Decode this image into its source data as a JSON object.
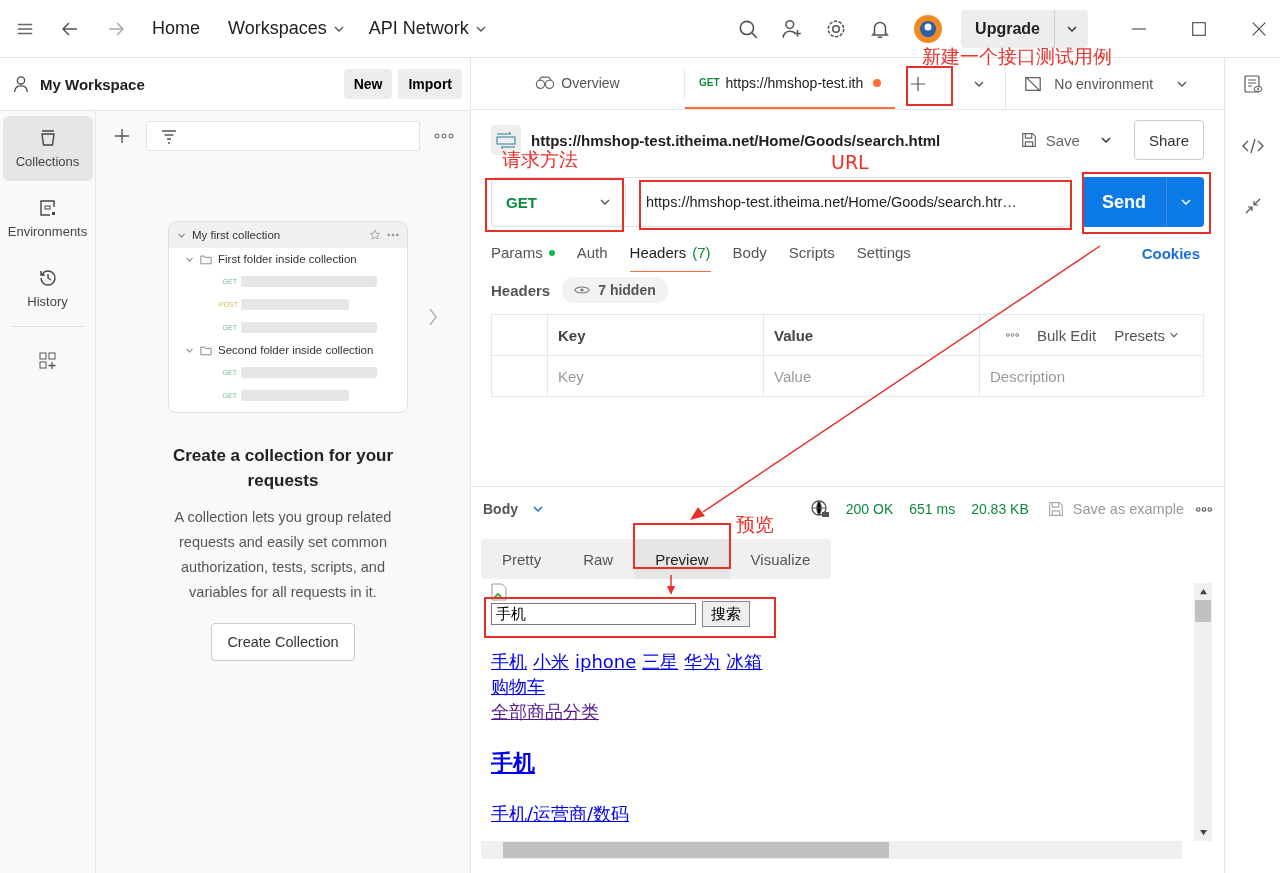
{
  "nav": {
    "home": "Home",
    "menus": [
      "Workspaces",
      "API Network"
    ],
    "upgrade": "Upgrade"
  },
  "workspace": {
    "name": "My Workspace",
    "buttons": [
      "New",
      "Import"
    ]
  },
  "rail": [
    {
      "kind": "collections",
      "label": "Collections",
      "selected": true
    },
    {
      "kind": "environments",
      "label": "Environments",
      "selected": false
    },
    {
      "kind": "history",
      "label": "History",
      "selected": false
    }
  ],
  "sample": {
    "title": "My first collection",
    "folders": [
      {
        "name": "First folder inside collection",
        "requests": [
          {
            "method": "GET"
          },
          {
            "method": "POST"
          },
          {
            "method": "GET"
          }
        ]
      },
      {
        "name": "Second folder inside collection",
        "requests": [
          {
            "method": "GET"
          },
          {
            "method": "GET"
          }
        ]
      }
    ]
  },
  "empty_state": {
    "title": "Create a collection for your requests",
    "text": "A collection lets you group related requests and easily set common authorization, tests, scripts, and variables for all requests in it.",
    "button": "Create Collection"
  },
  "tabs": [
    {
      "kind": "overview",
      "label": "Overview",
      "selected": false,
      "unsaved": false
    },
    {
      "kind": "request",
      "method": "GET",
      "label": "https://hmshop-test.ith",
      "selected": true,
      "unsaved": true
    }
  ],
  "environment": "No environment",
  "request": {
    "title": "https://hmshop-test.itheima.net/Home/Goods/search.html",
    "save": "Save",
    "share": "Share",
    "method": "GET",
    "url": "https://hmshop-test.itheima.net/Home/Goods/search.htr…",
    "send": "Send"
  },
  "request_tabs": [
    {
      "label": "Params",
      "dot": true,
      "selected": false
    },
    {
      "label": "Auth",
      "dot": false,
      "selected": false
    },
    {
      "label": "Headers",
      "count": "(7)",
      "dot": false,
      "selected": true
    },
    {
      "label": "Body",
      "dot": false,
      "selected": false
    },
    {
      "label": "Scripts",
      "dot": false,
      "selected": false
    },
    {
      "label": "Settings",
      "dot": false,
      "selected": false
    }
  ],
  "cookies": "Cookies",
  "headers": {
    "label": "Headers",
    "hidden": "7 hidden",
    "columns": [
      "Key",
      "Value"
    ],
    "actions": [
      "Bulk Edit",
      "Presets"
    ],
    "placeholders": [
      "Key",
      "Value",
      "Description"
    ]
  },
  "response": {
    "label": "Body",
    "status": "200 OK",
    "time": "651 ms",
    "size": "20.83 KB",
    "save": "Save as example",
    "views": [
      {
        "label": "Pretty",
        "selected": false
      },
      {
        "label": "Raw",
        "selected": false
      },
      {
        "label": "Preview",
        "selected": true
      },
      {
        "label": "Visualize",
        "selected": false
      }
    ]
  },
  "preview": {
    "search_value": "手机",
    "search_button": "搜索",
    "link_rows": [
      [
        {
          "text": "手机",
          "visited": false
        },
        {
          "text": "小米",
          "visited": false
        },
        {
          "text": "iphone",
          "visited": false
        },
        {
          "text": "三星",
          "visited": false
        },
        {
          "text": "华为",
          "visited": false
        },
        {
          "text": "冰箱",
          "visited": false
        }
      ],
      [
        {
          "text": "购物车",
          "visited": false
        }
      ],
      [
        {
          "text": "全部商品分类",
          "visited": true
        }
      ]
    ],
    "heading": "手机",
    "category": "手机/运营商/数码"
  },
  "annotations": [
    "新建一个接口测试用例",
    "请求方法",
    "URL",
    "预览"
  ]
}
